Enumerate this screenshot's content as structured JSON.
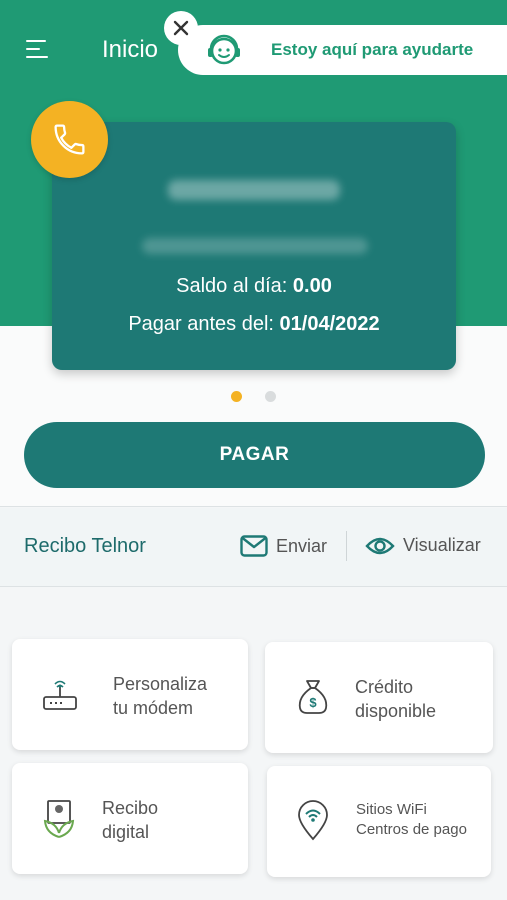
{
  "header": {
    "title": "Inicio",
    "help_text": "Estoy aquí para ayudarte"
  },
  "card": {
    "balance_label": "Saldo al día:",
    "balance_value": "0.00",
    "due_label": "Pagar antes del:",
    "due_date": "01/04/2022",
    "carousel_dots": 2,
    "active_dot": 1
  },
  "pay_button": "PAGAR",
  "receipt": {
    "title": "Recibo Telnor",
    "send_label": "Enviar",
    "view_label": "Visualizar"
  },
  "tiles": [
    {
      "line1": "Personaliza",
      "line2": "tu módem",
      "icon": "router-icon"
    },
    {
      "line1": "Crédito",
      "line2": "disponible",
      "icon": "money-bag-icon"
    },
    {
      "line1": "Recibo",
      "line2": "digital",
      "icon": "eco-receipt-icon"
    },
    {
      "line1": "Sitios WiFi",
      "line2": "Centros de pago",
      "icon": "wifi-location-icon"
    }
  ],
  "colors": {
    "brand_green": "#1f9a74",
    "teal": "#1e7975",
    "accent_yellow": "#f4b223"
  }
}
